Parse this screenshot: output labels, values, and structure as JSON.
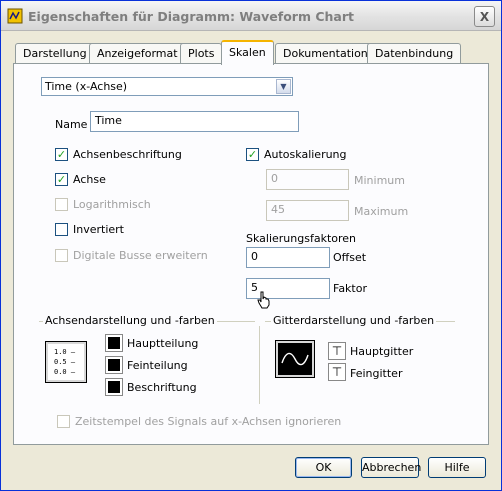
{
  "window": {
    "title": "Eigenschaften für Diagramm: Waveform Chart",
    "close_glyph": "X"
  },
  "tabs": [
    {
      "label": "Darstellung",
      "active": false
    },
    {
      "label": "Anzeigeformat",
      "active": false
    },
    {
      "label": "Plots",
      "active": false
    },
    {
      "label": "Skalen",
      "active": true
    },
    {
      "label": "Dokumentation",
      "active": false
    },
    {
      "label": "Datenbindung",
      "active": false
    }
  ],
  "scale": {
    "selector_value": "Time (x-Achse)",
    "name_label": "Name",
    "name_value": "Time",
    "checkboxes": {
      "axis_label": {
        "label": "Achsenbeschriftung",
        "checked": true,
        "enabled": true
      },
      "axis": {
        "label": "Achse",
        "checked": true,
        "enabled": true
      },
      "logarithmic": {
        "label": "Logarithmisch",
        "checked": false,
        "enabled": false
      },
      "inverted": {
        "label": "Invertiert",
        "checked": false,
        "enabled": true
      },
      "expand_digital": {
        "label": "Digitale Busse erweitern",
        "checked": false,
        "enabled": false
      },
      "autoscale": {
        "label": "Autoskalierung",
        "checked": true,
        "enabled": true
      }
    },
    "minimum": {
      "label": "Minimum",
      "value": "0"
    },
    "maximum": {
      "label": "Maximum",
      "value": "45"
    },
    "scaling_factors_label": "Skalierungsfaktoren",
    "offset": {
      "label": "Offset",
      "value": "0"
    },
    "factor": {
      "label": "Faktor",
      "value": "5"
    }
  },
  "axis_style": {
    "title": "Achsendarstellung und -farben",
    "scale_icon_lines": [
      "1.0 –",
      "0.5 –",
      "0.0 –"
    ],
    "items": [
      "Hauptteilung",
      "Feinteilung",
      "Beschriftung"
    ],
    "swatch_color": "#000000"
  },
  "grid_style": {
    "title": "Gitterdarstellung und -farben",
    "items": [
      "Hauptgitter",
      "Feingitter"
    ]
  },
  "ignore_timestamp": {
    "label": "Zeitstempel des Signals auf x-Achsen ignorieren",
    "checked": false,
    "enabled": false
  },
  "buttons": {
    "ok": "OK",
    "cancel": "Abbrechen",
    "help": "Hilfe"
  },
  "colors": {
    "title_bar_border": "#0831d9",
    "active_tab_accent": "#f5b400",
    "check_green": "#21a121"
  }
}
